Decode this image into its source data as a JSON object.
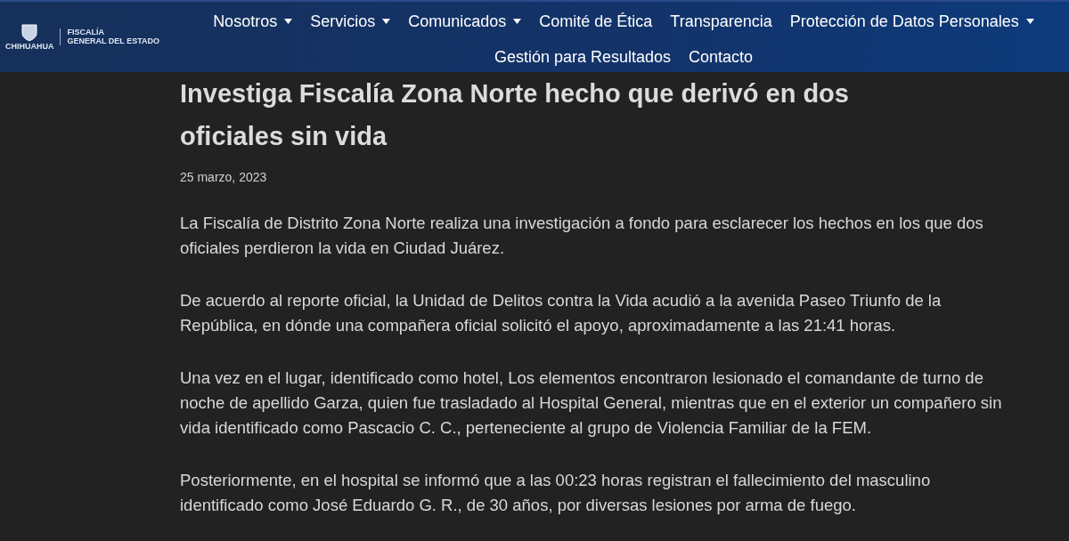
{
  "logo": {
    "state": "CHIHUAHUA",
    "agency_line1": "FISCALÍA",
    "agency_line2": "GENERAL DEL ESTADO"
  },
  "nav": [
    {
      "label": "Nosotros",
      "dropdown": true
    },
    {
      "label": "Servicios",
      "dropdown": true
    },
    {
      "label": "Comunicados",
      "dropdown": true
    },
    {
      "label": "Comité de Ética",
      "dropdown": false
    },
    {
      "label": "Transparencia",
      "dropdown": false
    },
    {
      "label": "Protección de Datos Personales",
      "dropdown": true
    },
    {
      "label": "Gestión para Resultados",
      "dropdown": false
    },
    {
      "label": "Contacto",
      "dropdown": false
    }
  ],
  "article": {
    "title": "Investiga Fiscalía Zona Norte hecho que derivó en dos oficiales sin vida",
    "date": "25 marzo, 2023",
    "paragraphs": [
      "La Fiscalía de Distrito Zona Norte realiza una investigación a fondo para esclarecer los hechos en los que dos oficiales perdieron la vida en Ciudad Juárez.",
      "De acuerdo al reporte oficial, la Unidad de Delitos contra la Vida acudió a la avenida Paseo Triunfo de la República, en dónde una compañera oficial solicitó el apoyo, aproximadamente a las 21:41 horas.",
      "Una vez en el lugar, identificado como hotel, Los elementos encontraron lesionado el comandante de turno de noche de apellido Garza, quien fue trasladado al Hospital General, mientras que en el exterior un compañero sin vida identificado como Pascacio C. C., perteneciente al grupo de Violencia Familiar de la FEM.",
      "Posteriormente, en el hospital se informó que a las 00:23 horas registran el fallecimiento del masculino identificado como José Eduardo G. R., de 30 años, por diversas lesiones por arma de fuego."
    ]
  }
}
